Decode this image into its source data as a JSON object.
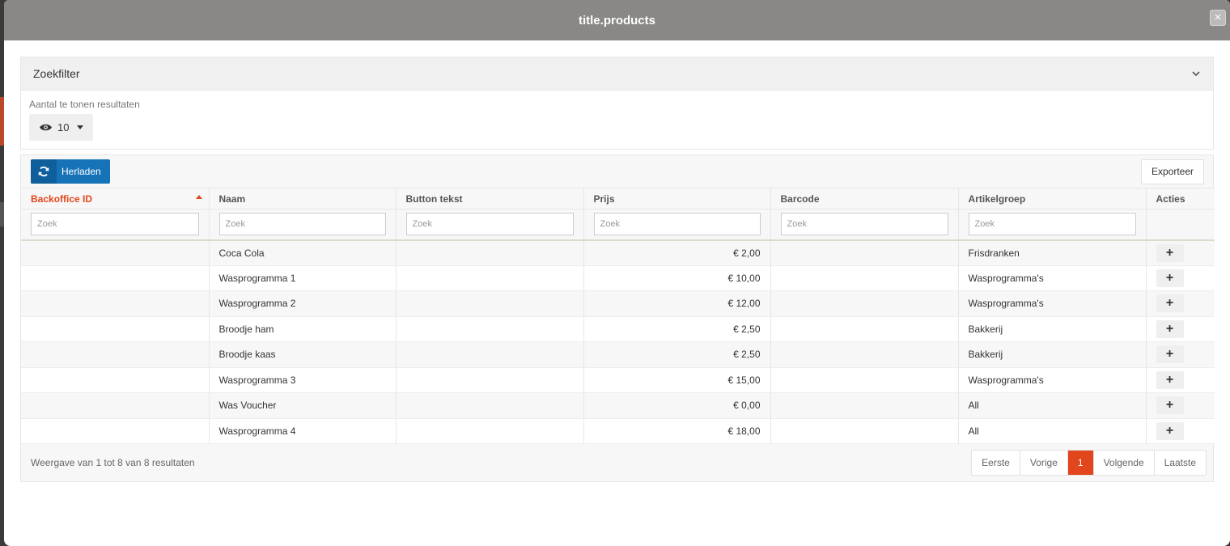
{
  "modal": {
    "title": "title.products",
    "close_glyph": "×"
  },
  "filter": {
    "title": "Zoekfilter",
    "count_label": "Aantal te tonen resultaten",
    "count_value": "10"
  },
  "toolbar": {
    "reload_label": "Herladen",
    "export_label": "Exporteer"
  },
  "table": {
    "columns": [
      "Backoffice ID",
      "Naam",
      "Button tekst",
      "Prijs",
      "Barcode",
      "Artikelgroep",
      "Acties"
    ],
    "search_placeholder": "Zoek",
    "rows": [
      {
        "id": "",
        "name": "Coca Cola",
        "button_text": "",
        "price": "€ 2,00",
        "barcode": "",
        "group": "Frisdranken"
      },
      {
        "id": "",
        "name": "Wasprogramma 1",
        "button_text": "",
        "price": "€ 10,00",
        "barcode": "",
        "group": "Wasprogramma's"
      },
      {
        "id": "",
        "name": "Wasprogramma 2",
        "button_text": "",
        "price": "€ 12,00",
        "barcode": "",
        "group": "Wasprogramma's"
      },
      {
        "id": "",
        "name": "Broodje ham",
        "button_text": "",
        "price": "€ 2,50",
        "barcode": "",
        "group": "Bakkerij"
      },
      {
        "id": "",
        "name": "Broodje kaas",
        "button_text": "",
        "price": "€ 2,50",
        "barcode": "",
        "group": "Bakkerij"
      },
      {
        "id": "",
        "name": "Wasprogramma 3",
        "button_text": "",
        "price": "€ 15,00",
        "barcode": "",
        "group": "Wasprogramma's"
      },
      {
        "id": "",
        "name": "Was Voucher",
        "button_text": "",
        "price": "€ 0,00",
        "barcode": "",
        "group": "All"
      },
      {
        "id": "",
        "name": "Wasprogramma 4",
        "button_text": "",
        "price": "€ 18,00",
        "barcode": "",
        "group": "All"
      }
    ],
    "action_glyph": "+"
  },
  "footer": {
    "info": "Weergave van 1 tot 8 van 8 resultaten",
    "pager": {
      "first": "Eerste",
      "prev": "Vorige",
      "current": "1",
      "next": "Volgende",
      "last": "Laatste"
    }
  },
  "colors": {
    "accent": "#e2461d",
    "primary": "#1673b8",
    "header": "#8a8886"
  }
}
